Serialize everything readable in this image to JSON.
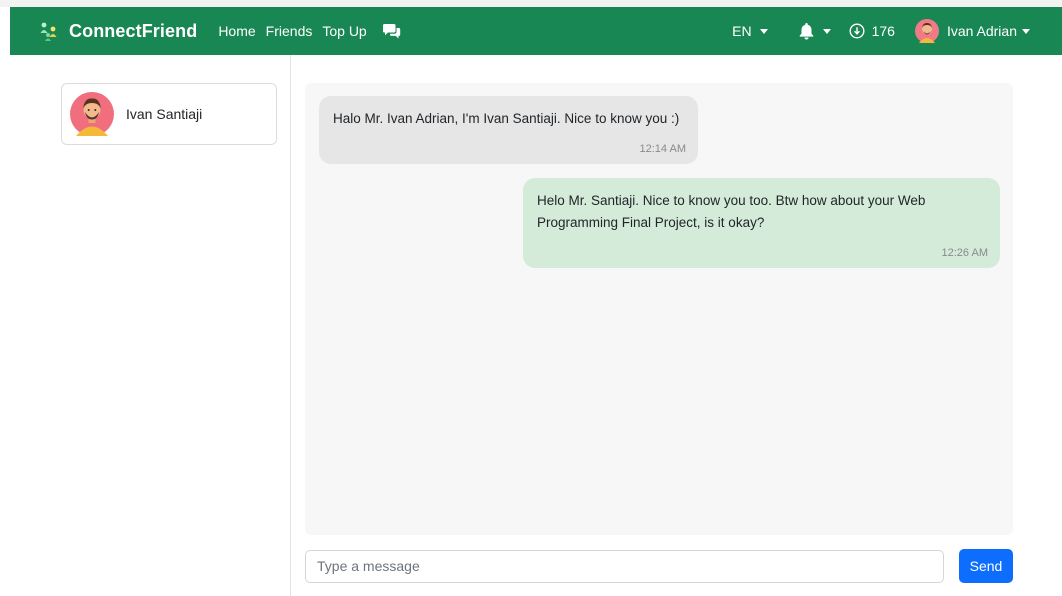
{
  "navbar": {
    "brand": "ConnectFriend",
    "links": [
      "Home",
      "Friends",
      "Top Up"
    ],
    "chat_icon": "chat-bubbles-icon",
    "language": "EN",
    "notification_icon": "bell-icon",
    "coin_icon": "coin-icon",
    "coins": "176",
    "user_name": "Ivan Adrian"
  },
  "sidebar": {
    "friends": [
      {
        "name": "Ivan Santiaji"
      }
    ]
  },
  "chat": {
    "messages": [
      {
        "direction": "incoming",
        "text": "Halo Mr. Ivan Adrian, I'm Ivan Santiaji. Nice to know you :)",
        "time": "12:14 AM"
      },
      {
        "direction": "outgoing",
        "text": "Helo Mr. Santiaji. Nice to know you too. Btw how about your Web Programming Final Project, is it okay?",
        "time": "12:26 AM"
      }
    ]
  },
  "composer": {
    "placeholder": "Type a message",
    "value": "",
    "send_label": "Send"
  },
  "colors": {
    "navbar": "#198754",
    "incoming_bubble": "#e6e6e6",
    "outgoing_bubble": "#d4ebd9",
    "send_button": "#0d6efd"
  }
}
